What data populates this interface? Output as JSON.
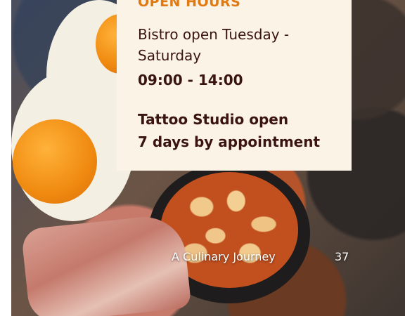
{
  "card": {
    "title": "OPEN HOURS",
    "bistro_line1": "Bistro open Tuesday -",
    "bistro_line2": "Saturday",
    "bistro_time": "09:00 - 14:00",
    "tattoo_line1": "Tattoo Studio open",
    "tattoo_line2": "7 days by appointment"
  },
  "footer": {
    "caption": "A Culinary Journey",
    "page_number": "37"
  },
  "colors": {
    "card_background": "#fbf3e6",
    "title_accent": "#e07a12",
    "body_text": "#3a1410"
  }
}
